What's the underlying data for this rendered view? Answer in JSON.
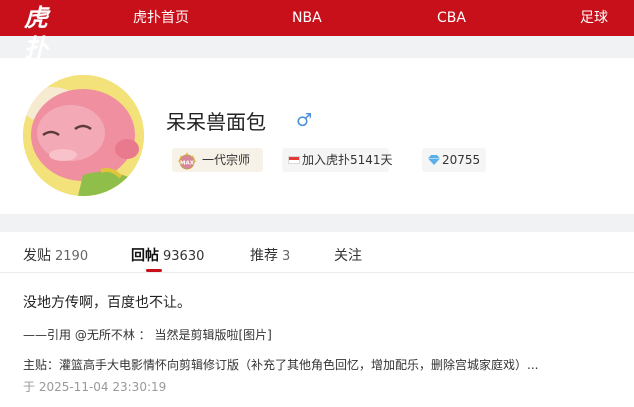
{
  "header": {
    "logo_text": "虎扑",
    "nav": [
      "虎扑首页",
      "NBA",
      "CBA",
      "足球"
    ]
  },
  "profile": {
    "username": "呆呆兽面包",
    "gender_icon": "male-icon",
    "gender_symbol": "♂",
    "rank_badge": "一代宗师",
    "rank_icon_text": "MAX",
    "join_text": "加入虎扑5141天",
    "points": "20755"
  },
  "tabs": [
    {
      "label": "发贴",
      "count": "2190"
    },
    {
      "label": "回帖",
      "count": "93630"
    },
    {
      "label": "推荐",
      "count": "3"
    },
    {
      "label": "关注",
      "count": ""
    }
  ],
  "post": {
    "text": "没地方传啊，百度也不让。",
    "quote": "——引用 @无所不林 ： 当然是剪辑版啦[图片]",
    "thread_prefix": "主贴：",
    "thread_title": "灌篮高手大电影情怀向剪辑修订版（补充了其他角色回忆，增加配乐，删除宫城家庭戏）...",
    "timestamp": "于 2025-11-04 23:30:19"
  },
  "colors": {
    "brand_red": "#c8101a",
    "page_bg": "#f1f2f4",
    "male_blue": "#4a8fd8"
  }
}
